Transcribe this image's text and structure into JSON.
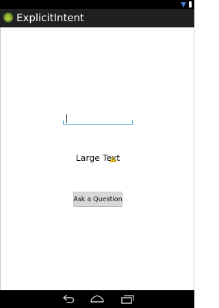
{
  "status_bar": {
    "icons": [
      "wifi-icon",
      "battery-icon"
    ],
    "wifi_color": "#3d7bd1"
  },
  "action_bar": {
    "title": "ExplicitIntent",
    "icon": "android-icon",
    "background": "#1f2021",
    "icon_color": "#a4c639"
  },
  "main": {
    "input": {
      "value": "",
      "placeholder": "",
      "underline_color": "#3d9fcf"
    },
    "label": "Large Text",
    "warning_icon": "warning-icon",
    "button_label": "Ask a Question"
  },
  "nav_bar": {
    "buttons": [
      "back-icon",
      "home-icon",
      "recents-icon"
    ]
  }
}
